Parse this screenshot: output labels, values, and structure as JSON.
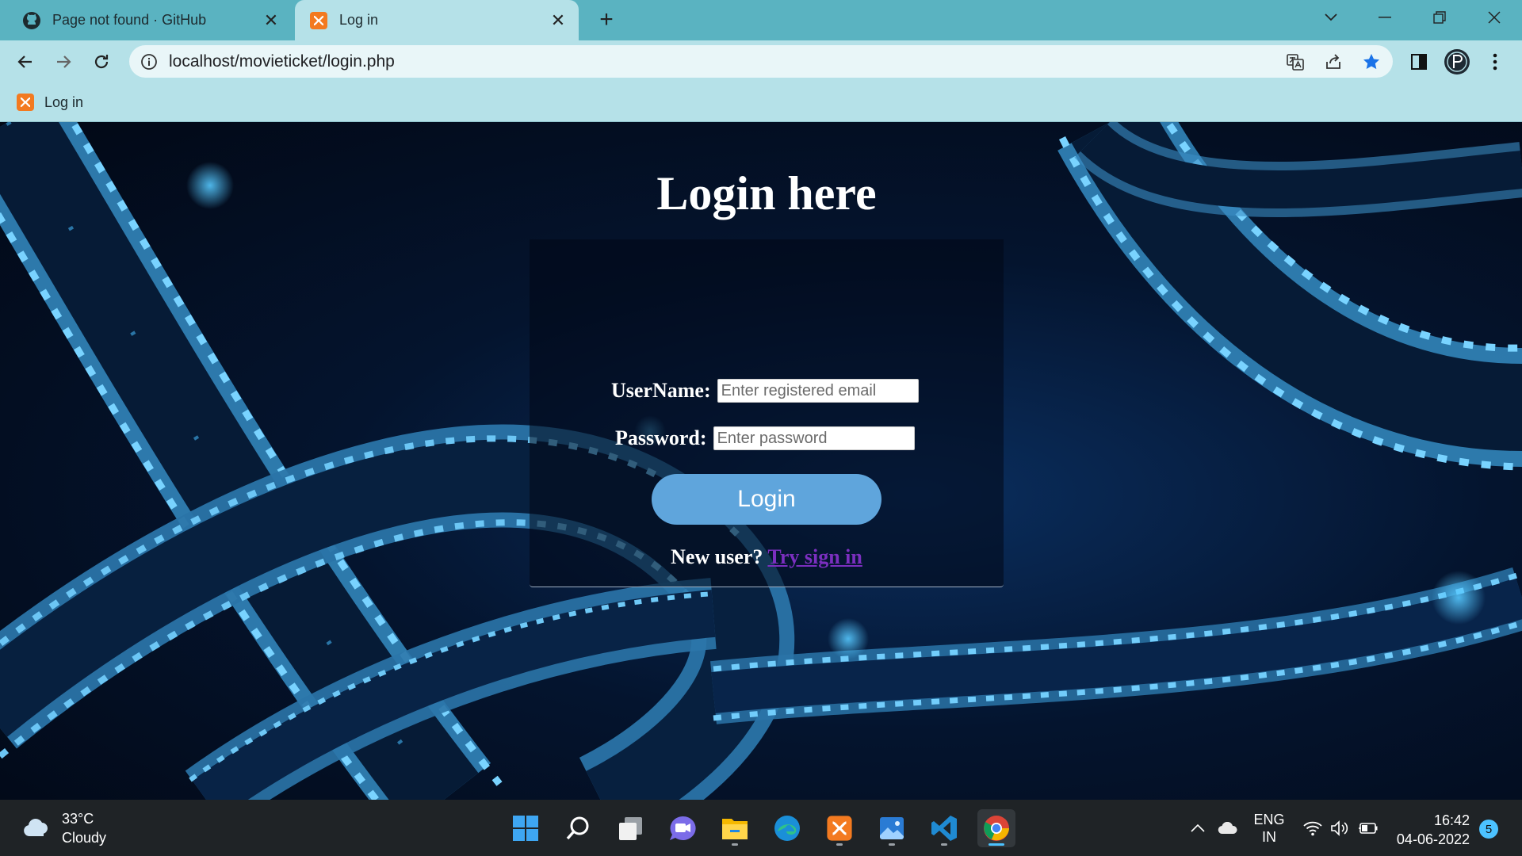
{
  "browser": {
    "tabs": [
      {
        "title": "Page not found · GitHub",
        "icon": "github-icon",
        "active": false
      },
      {
        "title": "Log in",
        "icon": "xampp-icon",
        "active": true
      }
    ],
    "new_tab_symbol": "+",
    "close_symbol": "✕",
    "address": "localhost/movieticket/login.php",
    "bookmarks": [
      {
        "label": "Log in",
        "icon": "xampp-icon"
      }
    ],
    "colors": {
      "tabstrip": "#5ab3c1",
      "toolbar": "#b5e1e8",
      "star": "#1a73e8"
    }
  },
  "login": {
    "title": "Login here",
    "username_label": "UserName:",
    "username_placeholder": "Enter registered email",
    "password_label": "Password:",
    "password_placeholder": "Enter password",
    "button_label": "Login",
    "new_user_text": "New user?",
    "signin_link": "Try sign in",
    "colors": {
      "button": "#5fa5dc",
      "link": "#7b2fbf"
    }
  },
  "taskbar": {
    "weather_temp": "33°C",
    "weather_desc": "Cloudy",
    "lang_top": "ENG",
    "lang_bottom": "IN",
    "time": "16:42",
    "date": "04-06-2022",
    "notifications": "5",
    "apps": [
      "start-icon",
      "search-icon",
      "task-view-icon",
      "chat-icon",
      "file-explorer-icon",
      "edge-icon",
      "xampp-icon",
      "photos-icon",
      "vscode-icon",
      "chrome-icon"
    ]
  }
}
